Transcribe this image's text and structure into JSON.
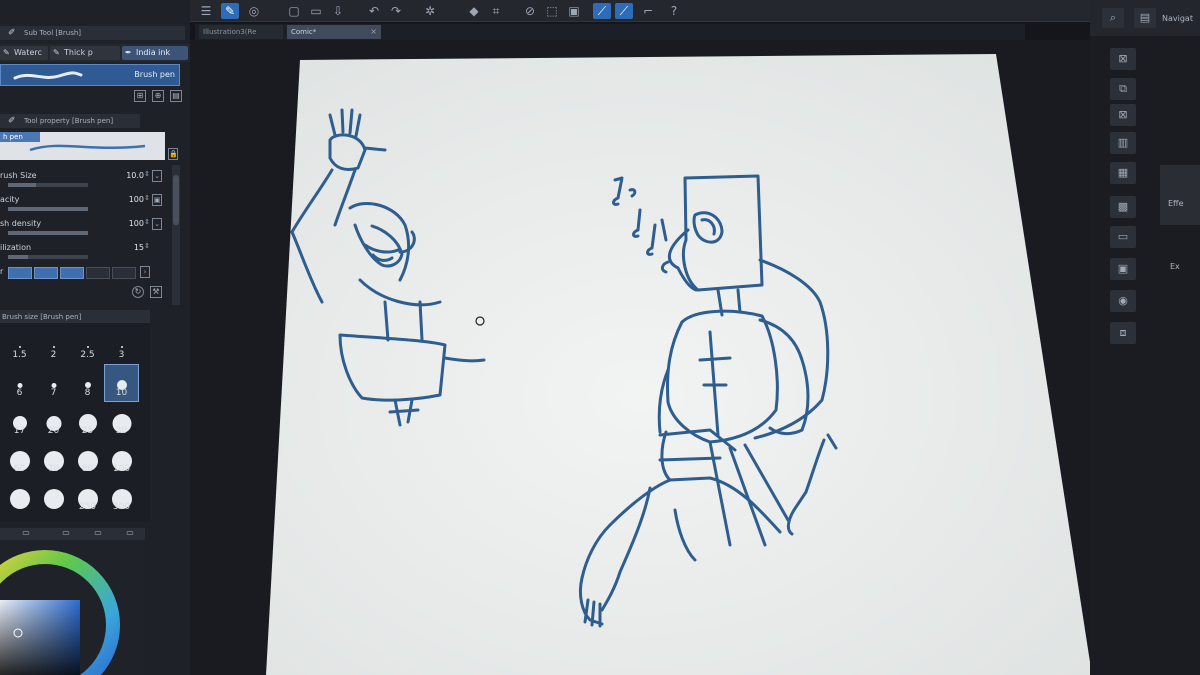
{
  "tabs": [
    {
      "label": "Illustration3(Re",
      "active": false
    },
    {
      "label": "Comic*",
      "active": true
    }
  ],
  "subtool_panel": {
    "title": "Sub Tool [Brush]",
    "tabs": [
      "Waterc",
      "Thick p",
      "India ink"
    ],
    "selected_brush": "Brush pen"
  },
  "tool_property": {
    "title": "Tool property [Brush pen]",
    "preview_label": "h pen",
    "props": [
      {
        "name": "rush Size",
        "value": "10.0",
        "fill": 0.35
      },
      {
        "name": "acity",
        "value": "100",
        "fill": 1.0
      },
      {
        "name": "sh density",
        "value": "100",
        "fill": 1.0
      },
      {
        "name": "ilization",
        "value": "15",
        "fill": 0.25
      }
    ],
    "swatch_label": "r"
  },
  "brush_size_panel": {
    "title": "Brush size [Brush pen]",
    "sizes": [
      "1.5",
      "2",
      "2.5",
      "3",
      "6",
      "7",
      "8",
      "10",
      "17",
      "20",
      "25",
      "30",
      "60",
      "70",
      "80",
      "100",
      "",
      "",
      "250",
      "300"
    ],
    "selected": "10"
  },
  "right_panel": {
    "labels": [
      "Navigat",
      "Effe",
      "Ex"
    ]
  },
  "colors": {
    "accent": "#2f6cb8",
    "ink": "#2e5d8f",
    "canvas": "#eceeed"
  }
}
